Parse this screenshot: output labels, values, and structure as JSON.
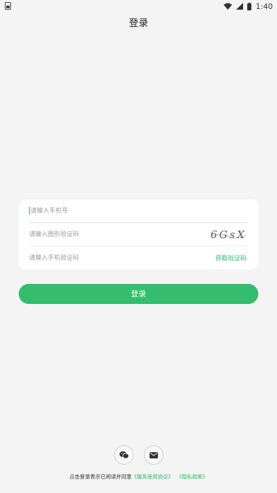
{
  "status_bar": {
    "time": "1:40",
    "icons": [
      "notification-icon",
      "wifi-icon",
      "signal-icon",
      "battery-icon"
    ]
  },
  "header": {
    "title": "登录"
  },
  "form": {
    "phone_placeholder": "请输入手机号",
    "captcha_placeholder": "请输入图形验证码",
    "captcha_text": "6GsX",
    "sms_placeholder": "请输入手机验证码",
    "get_code_label": "获取验证码"
  },
  "login_button": {
    "label": "登录"
  },
  "social": {
    "icons": [
      "wechat-icon",
      "email-icon"
    ]
  },
  "agreement": {
    "prefix": "点击登录表示已阅读并同意",
    "service_link": "《服务使用协议》",
    "privacy_link": "《隐私政策》"
  },
  "colors": {
    "accent": "#33bd6c",
    "background": "#f4f4f4",
    "card": "#ffffff"
  }
}
